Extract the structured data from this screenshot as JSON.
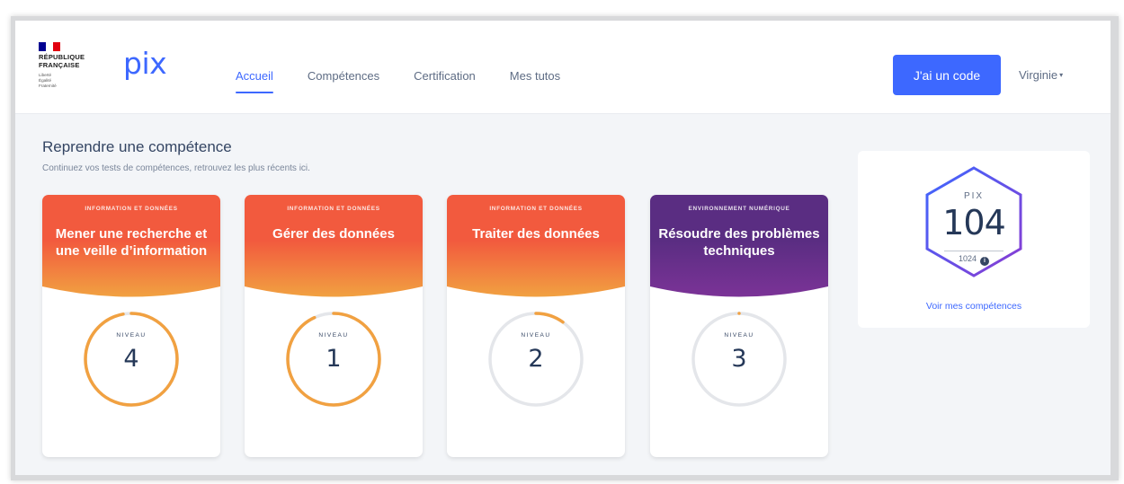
{
  "logo": {
    "rf_name": "RÉPUBLIQUE\nFRANÇAISE",
    "rf_motto": "Liberté\nÉgalité\nFraternité",
    "flag_colors": [
      "#000091",
      "#ffffff",
      "#e1000f"
    ],
    "brand": "pix"
  },
  "nav": {
    "items": [
      "Accueil",
      "Compétences",
      "Certification",
      "Mes tutos"
    ],
    "active_index": 0
  },
  "header": {
    "code_button": "J'ai un code",
    "user_name": "Virginie"
  },
  "main": {
    "title": "Reprendre une compétence",
    "subtitle": "Continuez vos tests de compétences, retrouvez les plus récents ici."
  },
  "cards": [
    {
      "area": "INFORMATION ET DONNÉES",
      "name": "Mener une recherche et une veille d’information",
      "level_label": "NIVEAU",
      "level": "4",
      "progress": 0.97,
      "header_colors": [
        "#f1a141",
        "#f25a3e"
      ]
    },
    {
      "area": "INFORMATION ET DONNÉES",
      "name": "Gérer des données",
      "level_label": "NIVEAU",
      "level": "1",
      "progress": 0.93,
      "header_colors": [
        "#f1a141",
        "#f25a3e"
      ]
    },
    {
      "area": "INFORMATION ET DONNÉES",
      "name": "Traiter des données",
      "level_label": "NIVEAU",
      "level": "2",
      "progress": 0.1,
      "header_colors": [
        "#f1a141",
        "#f25a3e"
      ]
    },
    {
      "area": "ENVIRONNEMENT NUMÉRIQUE",
      "name": "Résoudre des problèmes techniques",
      "level_label": "NIVEAU",
      "level": "3",
      "progress": 0,
      "header_colors": [
        "#7b3397",
        "#5a2d82"
      ]
    }
  ],
  "score": {
    "label": "PIX",
    "value": "104",
    "max": "1024",
    "link": "Voir mes compétences"
  },
  "colors": {
    "accent": "#3d68ff",
    "level_progress": "#f1a141",
    "level_track": "#e4e6ea"
  }
}
